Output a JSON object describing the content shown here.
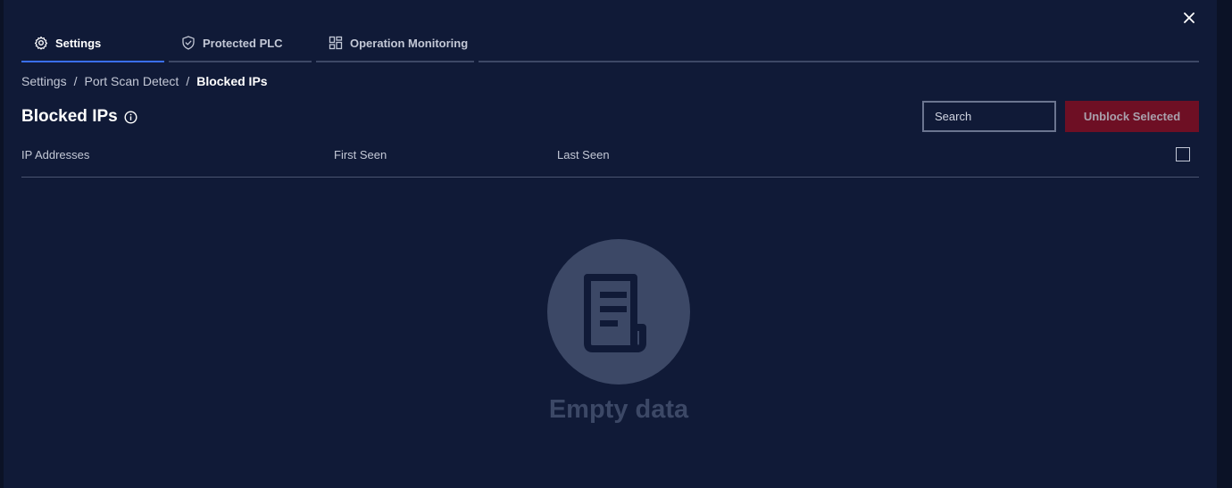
{
  "tabs": [
    {
      "label": "Settings",
      "icon": "gear-icon",
      "active": true
    },
    {
      "label": "Protected PLC",
      "icon": "shield-check-icon",
      "active": false
    },
    {
      "label": "Operation Monitoring",
      "icon": "dashboard-grid-icon",
      "active": false
    }
  ],
  "breadcrumb": {
    "items": [
      "Settings",
      "Port Scan Detect",
      "Blocked IPs"
    ],
    "separator": "/"
  },
  "page": {
    "title": "Blocked IPs",
    "info_icon": "info-icon"
  },
  "search": {
    "placeholder": "Search",
    "value": ""
  },
  "actions": {
    "unblock_label": "Unblock Selected"
  },
  "table": {
    "columns": [
      "IP Addresses",
      "First Seen",
      "Last Seen"
    ],
    "rows": []
  },
  "empty_state": {
    "icon": "document-icon",
    "text": "Empty data"
  },
  "colors": {
    "background": "#101a37",
    "active_tab": "#3a6ff0",
    "danger_button": "#6e0f24",
    "empty_icon": "#3c4866"
  }
}
